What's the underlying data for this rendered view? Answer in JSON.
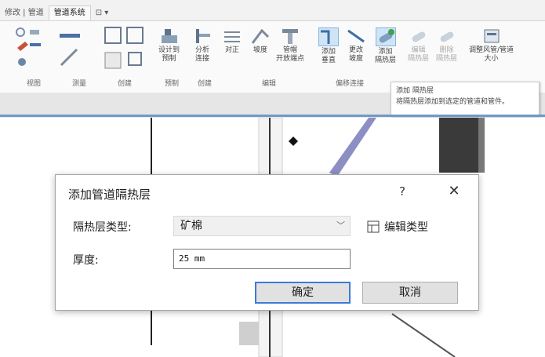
{
  "ribbon": {
    "tabs": [
      "修改 | 管道",
      "管道系统",
      "⊡ ▾"
    ],
    "tools": [
      {
        "name": "add-vertical-tool",
        "label1": "添加",
        "label2": "垂直"
      },
      {
        "name": "change-slope-tool",
        "label1": "更改",
        "label2": "坡度"
      },
      {
        "name": "add-insulation-tool",
        "label1": "添加",
        "label2": "隔热层"
      },
      {
        "name": "edit-insulation-tool",
        "label1": "编辑",
        "label2": "隔热层"
      },
      {
        "name": "remove-insulation-tool",
        "label1": "删除",
        "label2": "隔热层"
      },
      {
        "name": "resize-duct-tool",
        "label1": "调整风管/管道",
        "label2": "大小"
      }
    ],
    "group_labels": [
      "视图",
      "测量",
      "创建",
      "预制",
      "创建",
      "编辑",
      "偏移连接"
    ],
    "tooltip": {
      "title": "添加 隔热层",
      "desc": "将隔热层添加到选定的管道和管件。"
    }
  },
  "dialog": {
    "title": "添加管道隔热层",
    "help": "?",
    "close": "✕",
    "type_label": "隔热层类型:",
    "type_value": "矿棉",
    "edit_type": "编辑类型",
    "thickness_label": "厚度:",
    "thickness_value": "25 mm",
    "ok": "确定",
    "cancel": "取消"
  },
  "colors": {
    "ok_border": "#3b7bd6",
    "highlight": "#cfe4f5",
    "dialog_border": "#a6a6a6"
  }
}
